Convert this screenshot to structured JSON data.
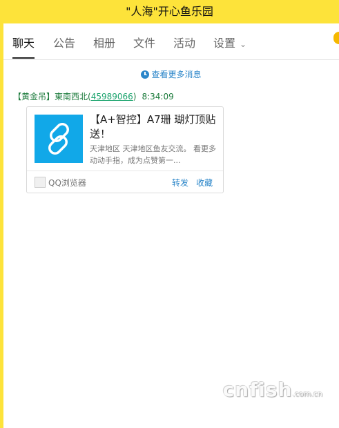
{
  "window": {
    "title": "\"人海\"开心鱼乐园"
  },
  "tabs": [
    {
      "label": "聊天",
      "active": true
    },
    {
      "label": "公告"
    },
    {
      "label": "相册"
    },
    {
      "label": "文件"
    },
    {
      "label": "活动"
    },
    {
      "label": "设置"
    }
  ],
  "chat": {
    "more_messages": "查看更多消息",
    "message": {
      "rank": "【黄金吊】",
      "nickname": "東南西北",
      "qq": "45989066",
      "time": "8:34:09",
      "card": {
        "title": "【A+智控】A7珊 瑚灯顶贴送！",
        "desc": "天津地区 天津地区鱼友交流。 看更多 动动手指，成为点赞第一...",
        "source": "QQ浏览器",
        "forward_label": "转发",
        "favorite_label": "收藏",
        "thumb_icon": "link-icon"
      }
    }
  },
  "watermark": {
    "text": "cnfish",
    "sub": ".com.cn"
  },
  "colors": {
    "title_bar": "#fde33a",
    "link": "#2b86c9",
    "sender": "#1a7a3a",
    "thumb": "#11a8e8"
  }
}
